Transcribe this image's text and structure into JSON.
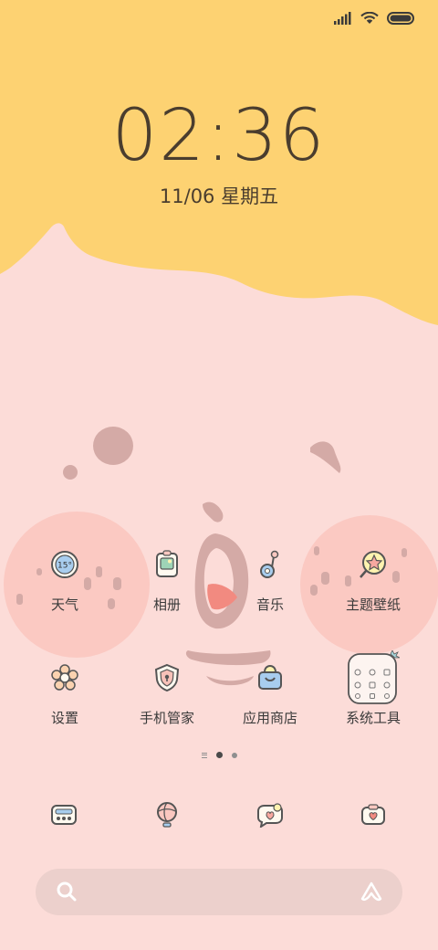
{
  "status_bar": {
    "signal_icon": "cellular-signal-icon",
    "wifi_icon": "wifi-icon",
    "battery_icon": "battery-icon"
  },
  "lock": {
    "time": "02:36",
    "date": "11/06 星期五"
  },
  "weather_badge": "15°",
  "apps": [
    {
      "label": "天气",
      "icon": "weather-icon"
    },
    {
      "label": "相册",
      "icon": "gallery-icon"
    },
    {
      "label": "音乐",
      "icon": "music-icon"
    },
    {
      "label": "主题壁纸",
      "icon": "themes-icon"
    },
    {
      "label": "设置",
      "icon": "settings-flower-icon"
    },
    {
      "label": "手机管家",
      "icon": "security-shield-icon"
    },
    {
      "label": "应用商店",
      "icon": "app-store-bag-icon"
    },
    {
      "label": "系统工具",
      "icon": "system-tools-folder-icon"
    }
  ],
  "page_indicator": {
    "pages": 2,
    "current": 1
  },
  "dock": [
    {
      "icon": "phone-dialer-icon"
    },
    {
      "icon": "browser-globe-icon"
    },
    {
      "icon": "messages-icon"
    },
    {
      "icon": "camera-icon"
    }
  ],
  "search_bar": {
    "search_icon": "search-icon",
    "assistant_icon": "assistant-icon"
  },
  "colors": {
    "wallpaper_pink": "#fcdcd8",
    "wallpaper_yellow": "#fdd272",
    "text_dark": "#4a3d2e"
  }
}
